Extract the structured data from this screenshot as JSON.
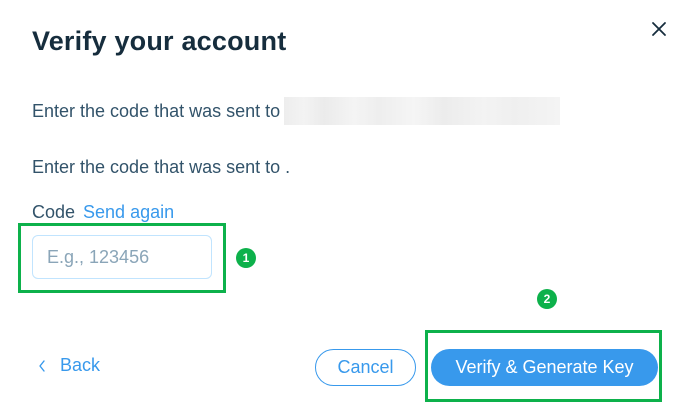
{
  "dialog": {
    "title": "Verify your account",
    "sent_to_text": "Enter the code that was sent to",
    "sent_to_text_2": "Enter the code that was sent to .",
    "code_label": "Code",
    "send_again": "Send again",
    "code_input": {
      "value": "",
      "placeholder": "E.g., 123456"
    },
    "back_label": "Back",
    "cancel_label": "Cancel",
    "verify_label": "Verify & Generate Key",
    "close_icon": "close-icon"
  },
  "annotations": {
    "step_1": "1",
    "step_2": "2",
    "highlight_color": "#0db14b"
  },
  "colors": {
    "accent": "#3899ec",
    "text_primary": "#162d3d",
    "text_secondary": "#32536a"
  }
}
